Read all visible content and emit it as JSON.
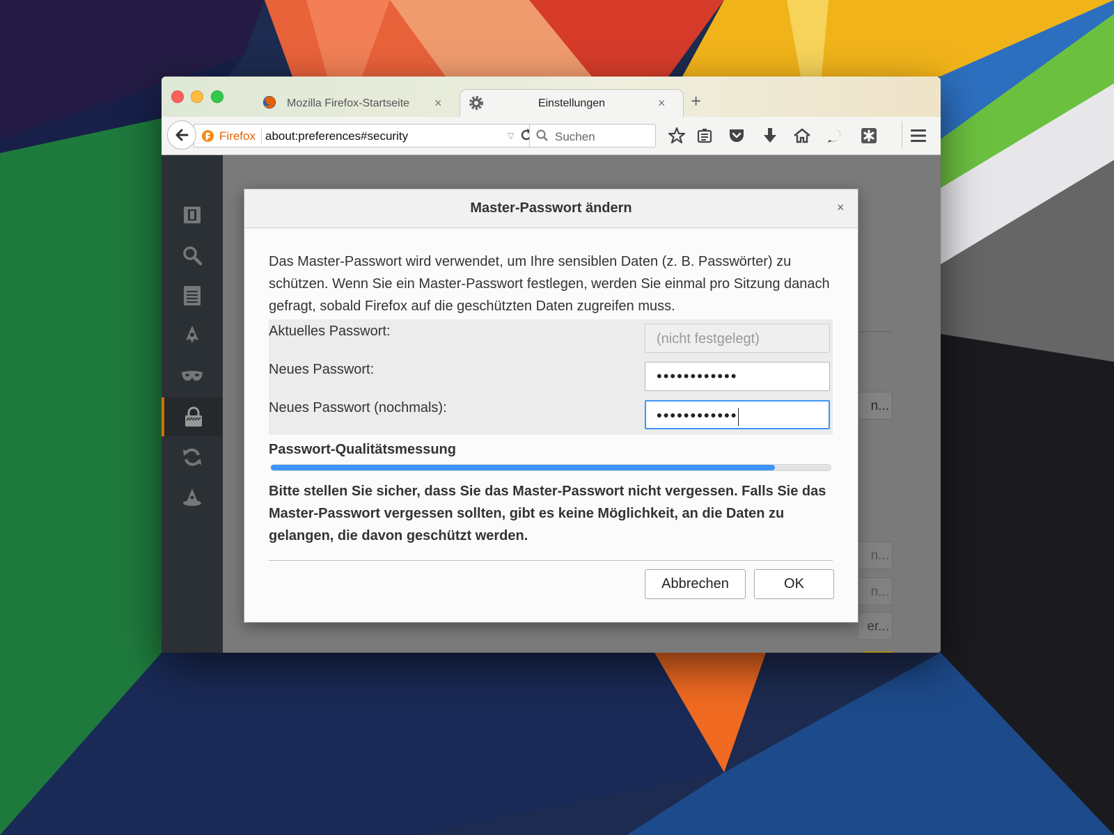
{
  "browser": {
    "tabs": [
      {
        "label": "Mozilla Firefox-Startseite",
        "close": "×"
      },
      {
        "label": "Einstellungen",
        "close": "×"
      }
    ],
    "new_tab": "+",
    "url": {
      "brand": "Firefox",
      "address": "about:preferences#security"
    },
    "search": {
      "placeholder": "Suchen"
    },
    "toolbar_icons": [
      "bookmark-star-icon",
      "reading-list-icon",
      "pocket-icon",
      "download-icon",
      "home-icon",
      "hello-icon",
      "extension-icon",
      "hamburger-menu-icon"
    ]
  },
  "sidebar": {
    "items": [
      {
        "icon": "general-icon"
      },
      {
        "icon": "search-icon"
      },
      {
        "icon": "content-icon"
      },
      {
        "icon": "applications-icon"
      },
      {
        "icon": "privacy-icon"
      },
      {
        "icon": "security-icon",
        "active": true
      },
      {
        "icon": "sync-icon"
      },
      {
        "icon": "advanced-icon"
      }
    ]
  },
  "background_page": {
    "buttons": [
      "n...",
      "n...",
      "n...",
      "er..."
    ],
    "help": "?"
  },
  "dialog": {
    "title": "Master-Passwort ändern",
    "close": "×",
    "description": "Das Master-Passwort wird verwendet, um Ihre sensiblen Daten (z. B. Passwörter) zu schützen. Wenn Sie ein Master-Passwort festlegen, werden Sie einmal pro Sitzung danach gefragt, sobald Firefox auf die geschützten Daten zugreifen muss.",
    "fields": [
      {
        "label": "Aktuelles Passwort:",
        "value": "(nicht festgelegt)",
        "state": "disabled"
      },
      {
        "label": "Neues Passwort:",
        "value": "••••••••••••",
        "state": "normal"
      },
      {
        "label": "Neues Passwort (nochmals):",
        "value": "••••••••••••",
        "state": "focused"
      }
    ],
    "quality_label": "Passwort-Qualitätsmessung",
    "quality_fraction": 0.9,
    "warning": "Bitte stellen Sie sicher, dass Sie das Master-Passwort nicht vergessen. Falls Sie das Master-Passwort vergessen sollten, gibt es keine Möglichkeit, an die Daten zu gelangen, die davon geschützt werden.",
    "buttons": {
      "cancel": "Abbrechen",
      "ok": "OK"
    }
  },
  "colors": {
    "accent_blue": "#3d94f6",
    "firefox_orange": "#e66000",
    "sidebar_active": "#d76e00",
    "help_yellow": "#b09018"
  }
}
